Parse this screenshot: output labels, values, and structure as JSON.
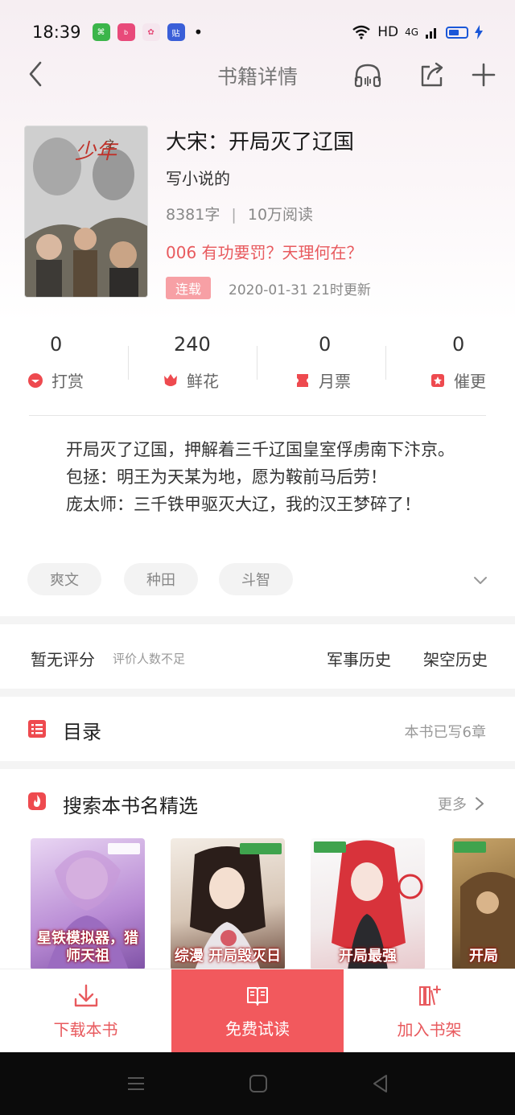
{
  "status_bar": {
    "time": "18:39",
    "app_icons": [
      {
        "name": "green-app-icon",
        "color": "#3bb54a",
        "glyph": "¤"
      },
      {
        "name": "bilibili-app-icon",
        "color": "#e84a7a",
        "glyph": "bili"
      },
      {
        "name": "flower-app-icon",
        "color": "#e6507c",
        "glyph": "✿"
      },
      {
        "name": "tieba-app-icon",
        "color": "#3a5fd8",
        "glyph": "贴"
      }
    ],
    "dot": "•",
    "network": "HD",
    "signal": "4G"
  },
  "nav": {
    "title": "书籍详情"
  },
  "book": {
    "title": "大宋：开局灭了辽国",
    "author": "写小说的",
    "word_count": "8381字",
    "separator": "|",
    "readers": "10万阅读",
    "latest_chapter": "006 有功要罚？天理何在？",
    "status": "连载",
    "updated": "2020-01-31 21时更新"
  },
  "counts": [
    {
      "value": "0",
      "label": "打赏",
      "icon": "reward-icon"
    },
    {
      "value": "240",
      "label": "鲜花",
      "icon": "flower-icon"
    },
    {
      "value": "0",
      "label": "月票",
      "icon": "ticket-icon"
    },
    {
      "value": "0",
      "label": "催更",
      "icon": "urge-icon"
    }
  ],
  "description": [
    "开局灭了辽国，押解着三千辽国皇室俘虏南下汴京。",
    "包拯：明王为天某为地，愿为鞍前马后劳！",
    "庞太师：三千铁甲驱灭大辽，我的汉王梦碎了！"
  ],
  "tags": [
    "爽文",
    "种田",
    "斗智"
  ],
  "rating": {
    "main": "暂无评分",
    "sub": "评价人数不足",
    "genres": [
      "军事历史",
      "架空历史"
    ]
  },
  "toc": {
    "title": "目录",
    "count": "本书已写6章"
  },
  "recommend": {
    "title": "搜索本书名精选",
    "more": "更多",
    "covers": [
      {
        "caption": "星铁模拟器，猎师天祖",
        "colors": [
          "#d9c2ea",
          "#a77ac9"
        ]
      },
      {
        "caption": "综漫 开局毁灭日",
        "colors": [
          "#efe6dc",
          "#7a5a4c"
        ]
      },
      {
        "caption": "开局最强",
        "colors": [
          "#f6f2f2",
          "#d8333b"
        ]
      },
      {
        "caption": "开局",
        "colors": [
          "#c8a56a",
          "#6b4a2a"
        ]
      }
    ]
  },
  "actions": {
    "download": "下载本书",
    "read": "免费试读",
    "shelf": "加入书架"
  },
  "colors": {
    "accent": "#f2595d",
    "text_red": "#e85a5e"
  }
}
